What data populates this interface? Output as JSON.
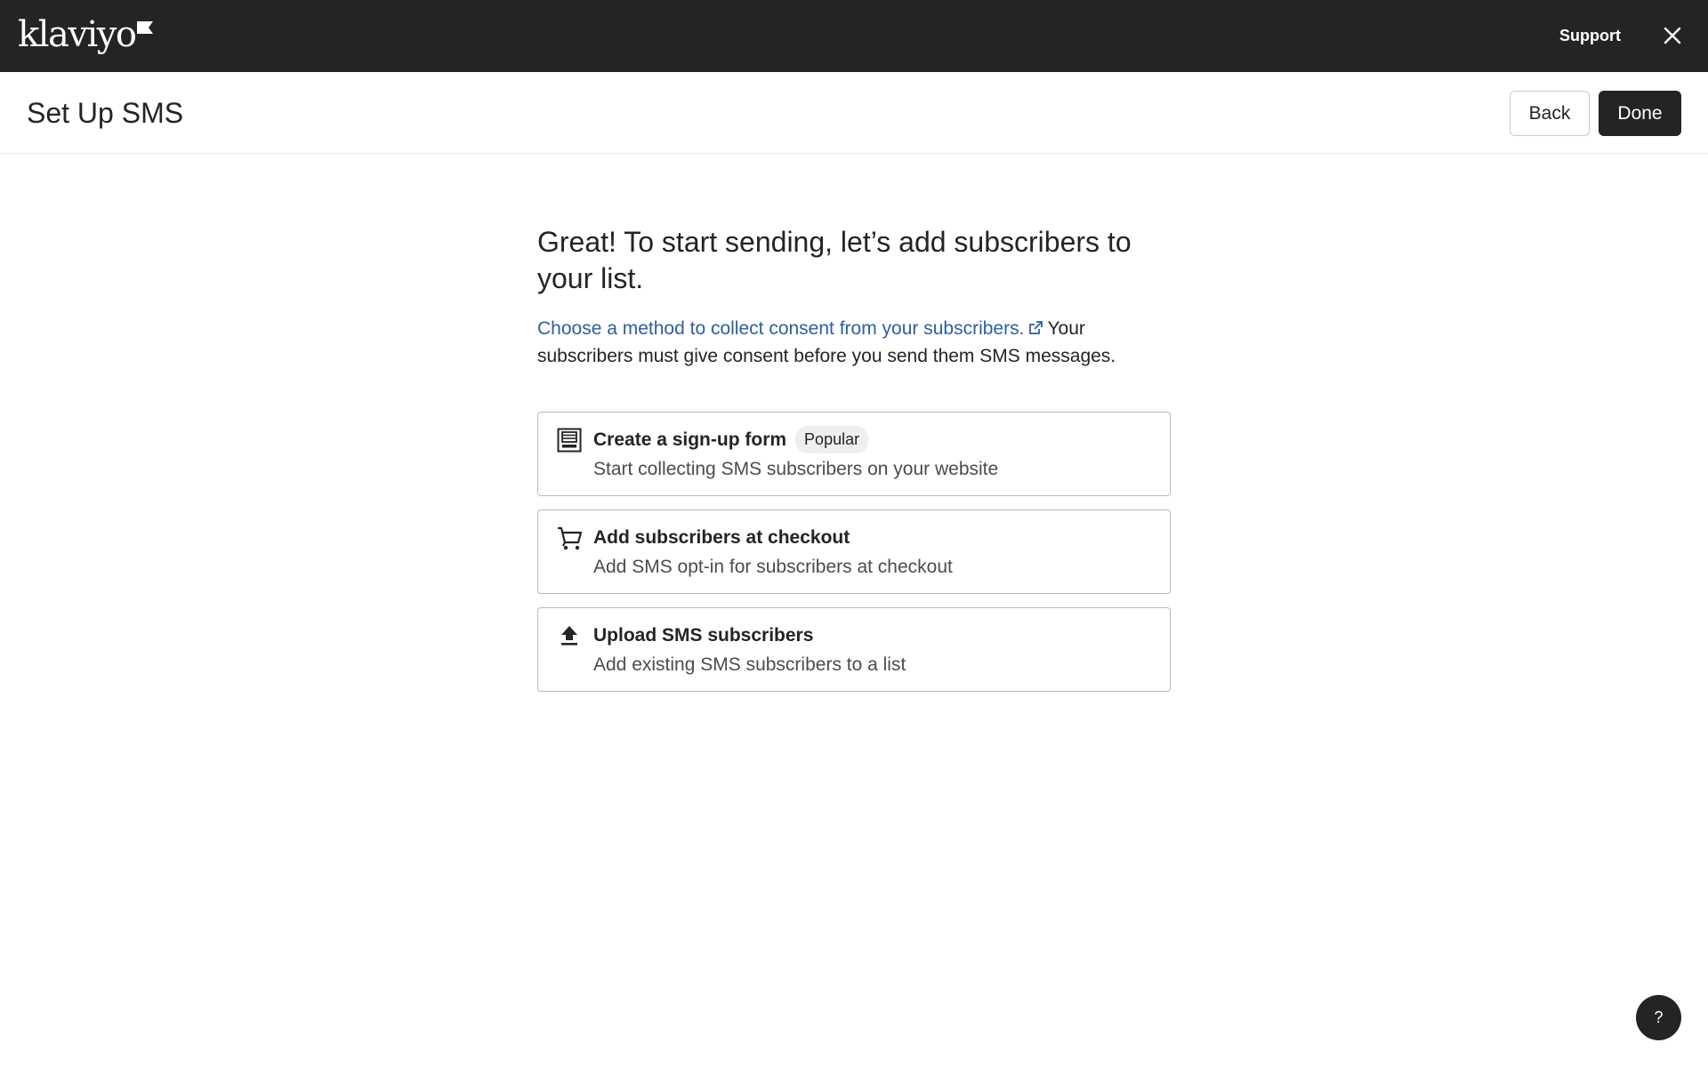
{
  "topbar": {
    "logo_text": "klaviyo",
    "logo_icon": "klaviyo-flag-icon",
    "support_label": "Support",
    "close_icon": "close-icon"
  },
  "header": {
    "title": "Set Up SMS",
    "back_label": "Back",
    "done_label": "Done"
  },
  "main": {
    "headline": "Great! To start sending, let’s add subscribers to your list.",
    "consent_link_text": "Choose a method to collect consent from your subscribers.",
    "external_link_icon": "external-link-icon",
    "consent_text": "Your subscribers must give consent before you send them SMS messages.",
    "options": [
      {
        "icon": "form-icon",
        "title": "Create a sign-up form",
        "badge": "Popular",
        "description": "Start collecting SMS subscribers on your website"
      },
      {
        "icon": "shopping-cart-icon",
        "title": "Add subscribers at checkout",
        "description": "Add SMS opt-in for subscribers at checkout"
      },
      {
        "icon": "upload-icon",
        "title": "Upload SMS subscribers",
        "description": "Add existing SMS subscribers to a list"
      }
    ]
  },
  "help": {
    "label": "?"
  },
  "colors": {
    "topbar_bg": "#232426",
    "link": "#2e5f9e",
    "primary_button": "#232426",
    "card_border": "#b8babd"
  }
}
